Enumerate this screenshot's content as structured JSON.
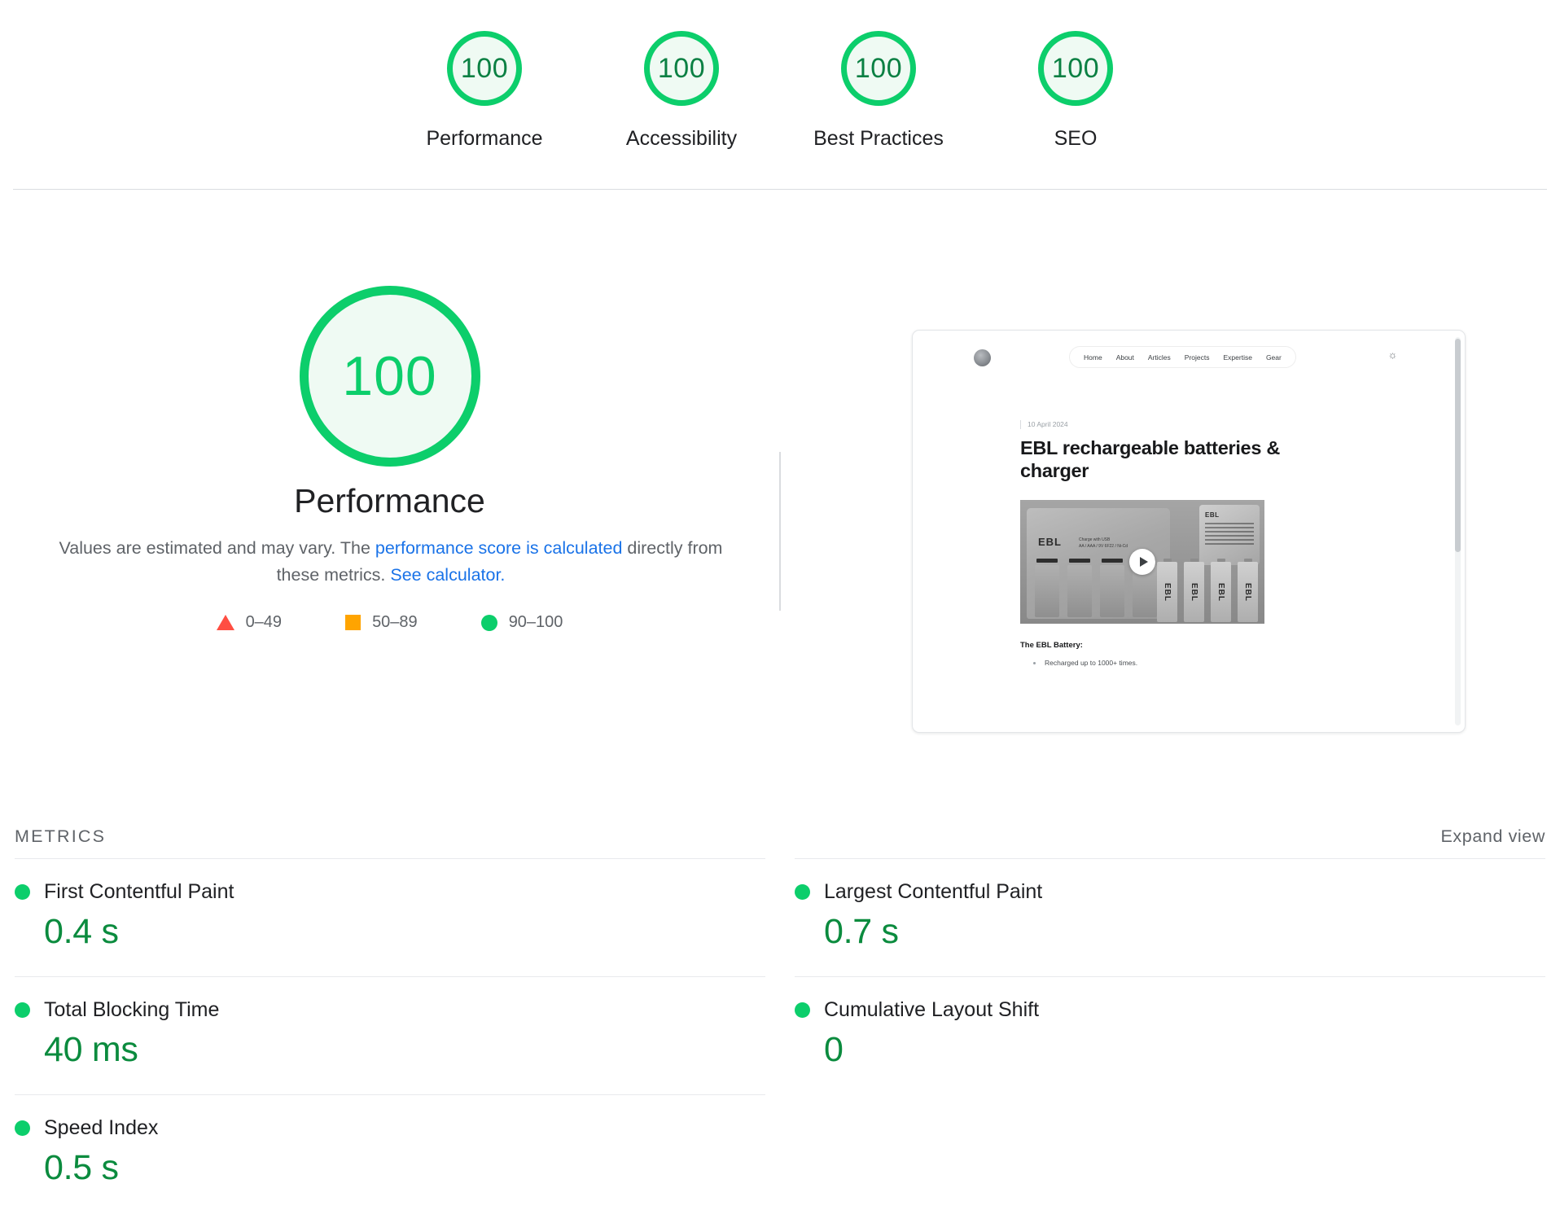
{
  "category_scores": [
    {
      "score": "100",
      "label": "Performance"
    },
    {
      "score": "100",
      "label": "Accessibility"
    },
    {
      "score": "100",
      "label": "Best Practices"
    },
    {
      "score": "100",
      "label": "SEO"
    }
  ],
  "performance": {
    "score": "100",
    "title": "Performance",
    "desc_part1": "Values are estimated and may vary. The ",
    "desc_link1": "performance score is calculated",
    "desc_part2": " directly from these metrics. ",
    "desc_link2": "See calculator."
  },
  "legend": [
    {
      "icon": "triangle-icon",
      "range": "0–49",
      "color": "#FF4E42"
    },
    {
      "icon": "square-icon",
      "range": "50–89",
      "color": "#FFA400"
    },
    {
      "icon": "circle-icon",
      "range": "90–100",
      "color": "#0CCE6B"
    }
  ],
  "metrics_section": {
    "title": "METRICS",
    "expand_label": "Expand view",
    "left_column": [
      {
        "name": "First Contentful Paint",
        "value": "0.4 s",
        "status": "pass"
      },
      {
        "name": "Total Blocking Time",
        "value": "40 ms",
        "status": "pass"
      },
      {
        "name": "Speed Index",
        "value": "0.5 s",
        "status": "pass"
      }
    ],
    "right_column": [
      {
        "name": "Largest Contentful Paint",
        "value": "0.7 s",
        "status": "pass"
      },
      {
        "name": "Cumulative Layout Shift",
        "value": "0",
        "status": "pass"
      }
    ]
  },
  "page_thumbnail": {
    "nav_items": [
      "Home",
      "About",
      "Articles",
      "Projects",
      "Expertise",
      "Gear"
    ],
    "date": "10 April 2024",
    "heading": "EBL rechargeable batteries & charger",
    "product_logo": "EBL",
    "product_caption": "Charge with USB",
    "product_caption_sub": "AA / AAA / 9V 6F22 / Ni-Cd",
    "battery_label": "EBL",
    "section_heading": "The EBL Battery:",
    "bullet_1": "Recharged up to 1000+ times."
  },
  "colors": {
    "pass_green": "#0CCE6B",
    "pass_green_text": "#0B8B3E",
    "average_orange": "#FFA400",
    "fail_red": "#FF4E42",
    "link_blue": "#1a73e8",
    "text_primary": "#202124",
    "text_secondary": "#5f6368"
  }
}
